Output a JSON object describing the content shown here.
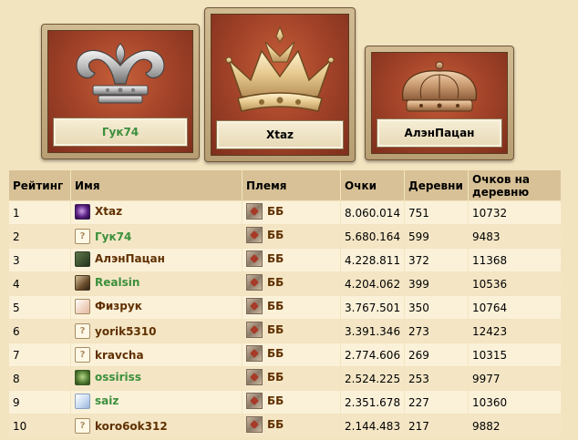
{
  "podium": [
    {
      "place": 2,
      "name": "Гук74",
      "crown": "silver-crown-icon",
      "name_color": "#3c8f3c"
    },
    {
      "place": 1,
      "name": "Xtaz",
      "crown": "gold-crown-icon",
      "name_color": "#000000"
    },
    {
      "place": 3,
      "name": "АлэнПацан",
      "crown": "bronze-crown-icon",
      "name_color": "#000000"
    }
  ],
  "table": {
    "headers": {
      "rank": "Рейтинг",
      "name": "Имя",
      "tribe": "Племя",
      "points": "Очки",
      "villages": "Деревни",
      "per_village": "Очков на деревню"
    },
    "rows": [
      {
        "rank": "1",
        "name": "Xtaz",
        "avatar": "purple-orb-avatar",
        "tribe": "ББ",
        "points": "8.060.014",
        "villages": "751",
        "per_village": "10732"
      },
      {
        "rank": "2",
        "name": "Гук74",
        "avatar": "placeholder-avatar",
        "tribe": "ББ",
        "points": "5.680.164",
        "villages": "599",
        "per_village": "9483"
      },
      {
        "rank": "3",
        "name": "АлэнПацан",
        "avatar": "warrior-avatar",
        "tribe": "ББ",
        "points": "4.228.811",
        "villages": "372",
        "per_village": "11368"
      },
      {
        "rank": "4",
        "name": "Realsin",
        "avatar": "soldier-avatar",
        "tribe": "ББ",
        "points": "4.204.062",
        "villages": "399",
        "per_village": "10536"
      },
      {
        "rank": "5",
        "name": "Физрук",
        "avatar": "cartoon-avatar",
        "tribe": "ББ",
        "points": "3.767.501",
        "villages": "350",
        "per_village": "10764"
      },
      {
        "rank": "6",
        "name": "yorik5310",
        "avatar": "placeholder-avatar",
        "tribe": "ББ",
        "points": "3.391.346",
        "villages": "273",
        "per_village": "12423"
      },
      {
        "rank": "7",
        "name": "kravcha",
        "avatar": "placeholder-avatar",
        "tribe": "ББ",
        "points": "2.774.606",
        "villages": "269",
        "per_village": "10315"
      },
      {
        "rank": "8",
        "name": "ossiriss",
        "avatar": "green-face-avatar",
        "tribe": "ББ",
        "points": "2.524.225",
        "villages": "253",
        "per_village": "9977"
      },
      {
        "rank": "9",
        "name": "saiz",
        "avatar": "chibi-avatar",
        "tribe": "ББ",
        "points": "2.351.678",
        "villages": "227",
        "per_village": "10360"
      },
      {
        "rank": "10",
        "name": "koro6ok312",
        "avatar": "placeholder-avatar",
        "tribe": "ББ",
        "points": "2.144.483",
        "villages": "217",
        "per_village": "9882"
      }
    ]
  },
  "colors": {
    "page_bg": "#f3e4c0",
    "header_bg": "#d8c196",
    "row_bg": "#fbf1d9",
    "row_alt_bg": "#f4e6c5",
    "player_link": "#603000",
    "player_link_green": "#3c8f3c"
  }
}
